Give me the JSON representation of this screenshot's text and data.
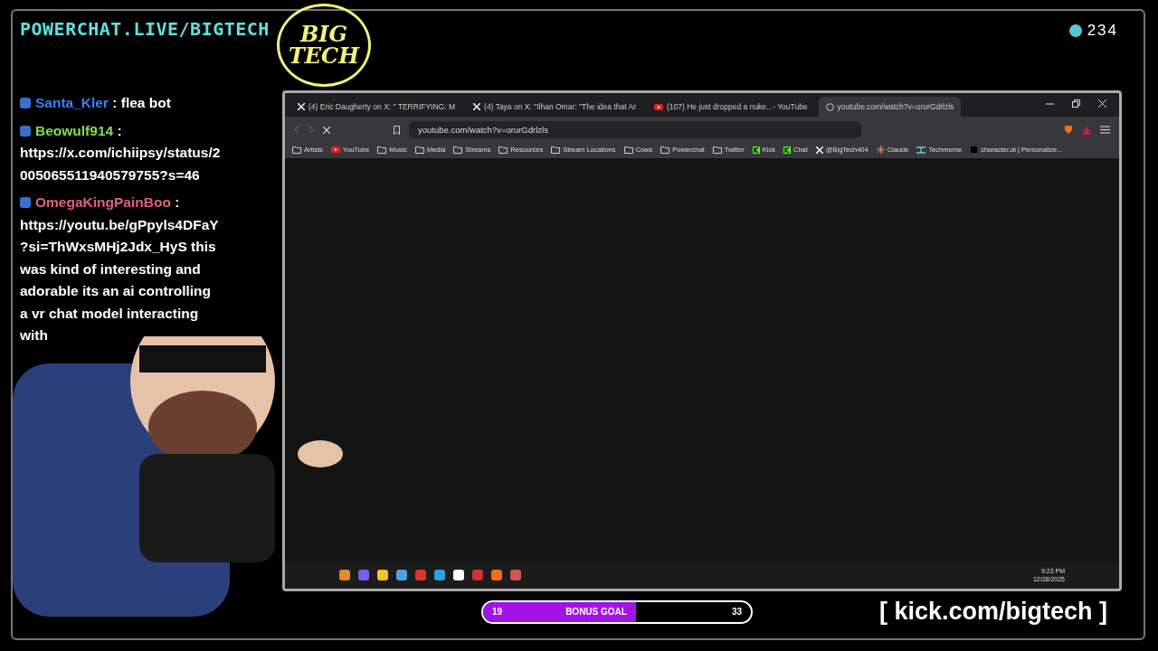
{
  "overlay": {
    "title": "POWERCHAT.LIVE/BIGTECH",
    "logo_lines": [
      "BIG",
      "TECH"
    ],
    "viewer_count": "234"
  },
  "chat": {
    "messages": [
      {
        "user": "Santa_Kler",
        "color": "#3b82f6",
        "separator": ":",
        "text": "flea bot"
      },
      {
        "user": "Beowulf914",
        "color": "#7ee04a",
        "separator": ":",
        "text": "https://x.com/ichiipsy/status/2005065511940579755?s=46"
      },
      {
        "user": "OmegaKingPainBoo",
        "color": "#e0607e",
        "separator": ":",
        "text": "https://youtu.be/gPpyls4DFaY?si=ThWxsMHj2Jdx_HyS this was kind of interesting and adorable its an ai controlling a vr chat model interacting with"
      }
    ]
  },
  "browser": {
    "tabs": [
      {
        "title": "(4) Eric Daugherty on X: \" TERRIFYING: M",
        "kind": "x",
        "selected": false
      },
      {
        "title": "(4) Taya on X: \"Ilhan Omar: \"The idea that Ar",
        "kind": "x",
        "selected": false
      },
      {
        "title": "(107) He just dropped a nuke.. - YouTube",
        "kind": "youtube",
        "selected": false
      },
      {
        "title": "youtube.com/watch?v=orurGdrlzls",
        "kind": "globe",
        "selected": true
      }
    ],
    "url": "youtube.com/watch?v=orurGdrlzls",
    "bookmarks": [
      {
        "label": "Artists",
        "kind": "folder"
      },
      {
        "label": "YouTube",
        "kind": "youtube"
      },
      {
        "label": "Music",
        "kind": "folder"
      },
      {
        "label": "Media",
        "kind": "folder"
      },
      {
        "label": "Streams",
        "kind": "folder"
      },
      {
        "label": "Resources",
        "kind": "folder"
      },
      {
        "label": "Stream Locations",
        "kind": "folder"
      },
      {
        "label": "Cows",
        "kind": "folder"
      },
      {
        "label": "Powerchat",
        "kind": "folder"
      },
      {
        "label": "Twitter",
        "kind": "folder"
      },
      {
        "label": "Kick",
        "kind": "kick"
      },
      {
        "label": "Chat",
        "kind": "kick"
      },
      {
        "label": "@BigTech404",
        "kind": "x"
      },
      {
        "label": "Claude",
        "kind": "claude"
      },
      {
        "label": "Techmeme",
        "kind": "techmeme"
      },
      {
        "label": "character.ai | Personalize...",
        "kind": "site"
      }
    ],
    "clock": {
      "time": "9:23 PM",
      "date": "12/28/2025"
    }
  },
  "goal": {
    "start": "19",
    "label": "BONUS GOAL",
    "end": "33",
    "level": 0.57
  },
  "footer_link": "[ kick.com/bigtech ]"
}
